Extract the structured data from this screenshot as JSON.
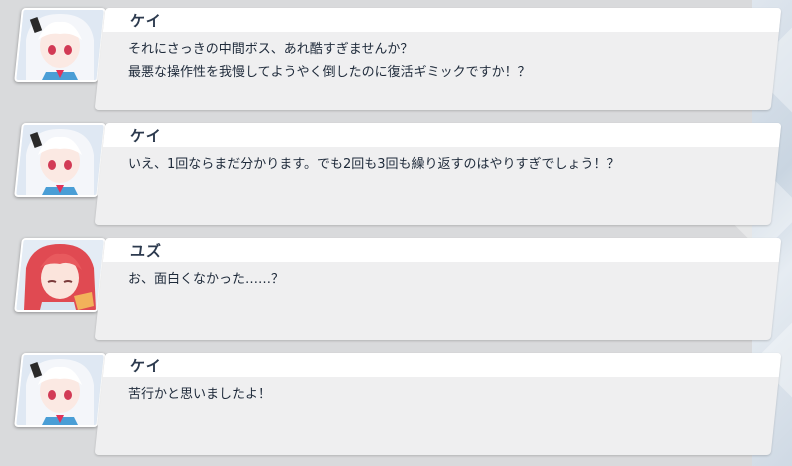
{
  "dialogue_log": [
    {
      "speaker": "ケイ",
      "character_icon": "kei-portrait",
      "lines": [
        "それにさっきの中間ボス、あれ酷すぎませんか？",
        "最悪な操作性を我慢してようやく倒したのに復活ギミックですか！？"
      ]
    },
    {
      "speaker": "ケイ",
      "character_icon": "kei-portrait",
      "lines": [
        "いえ、1回ならまだ分かります。でも2回も3回も繰り返すのはやりすぎでしょう！？"
      ]
    },
    {
      "speaker": "ユズ",
      "character_icon": "yuzu-portrait",
      "lines": [
        "お、面白くなかった……？"
      ]
    },
    {
      "speaker": "ケイ",
      "character_icon": "kei-portrait",
      "lines": [
        "苦行かと思いましたよ！"
      ]
    }
  ]
}
